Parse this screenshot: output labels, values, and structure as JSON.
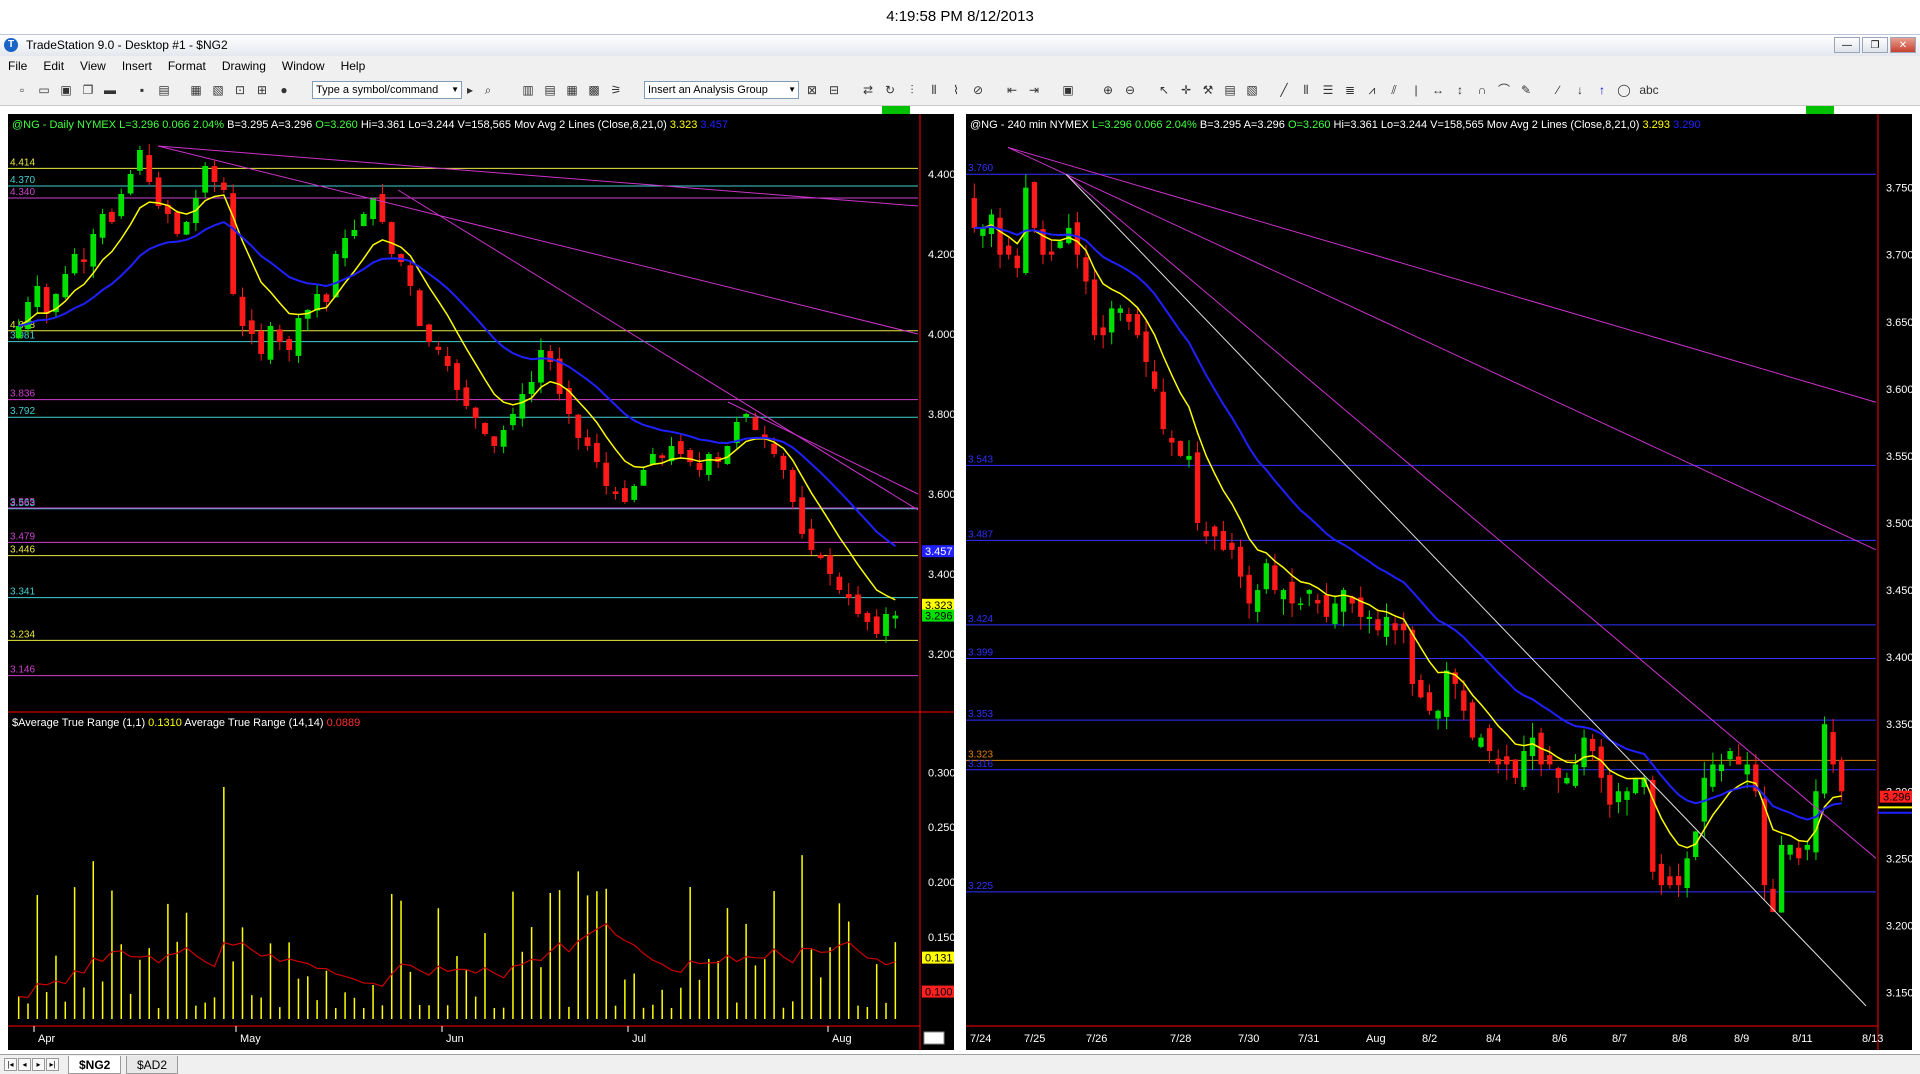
{
  "clock": "4:19:58 PM 8/12/2013",
  "window": {
    "title": "TradeStation 9.0 - Desktop #1 - $NG2"
  },
  "menu": [
    "File",
    "Edit",
    "View",
    "Insert",
    "Format",
    "Drawing",
    "Window",
    "Help"
  ],
  "toolbar": {
    "symbol_placeholder": "Type a symbol/command",
    "analysis_group": "Insert an Analysis Group"
  },
  "tabs": {
    "active": "$NG2",
    "other": "$AD2"
  },
  "colors": {
    "up": "#00e000",
    "down": "#ff1a1a",
    "ma_fast": "#ffff00",
    "ma_slow": "#2020ff",
    "trend": "#cc33cc",
    "support": "#00cccc"
  },
  "left_chart": {
    "header": {
      "symbol": "@NG - Daily",
      "exchange": "NYMEX",
      "last": "L=3.296",
      "change": "0.066",
      "pct": "2.04%",
      "bid": "B=3.295",
      "ask": "A=3.296",
      "open": "O=3.260",
      "high": "Hi=3.361",
      "low": "Lo=3.244",
      "volume": "V=158,565",
      "study": "Mov Avg 2 Lines (Close,8,21,0)",
      "ma_fast": "3.323",
      "ma_slow": "3.457"
    },
    "ylabels": [
      "4.400",
      "4.200",
      "4.000",
      "3.800",
      "3.600",
      "3.400",
      "3.200"
    ],
    "levels": [
      {
        "label": "4.414",
        "value": 4.414,
        "color": "#e8e840"
      },
      {
        "label": "4.370",
        "value": 4.37,
        "color": "#40d0d0"
      },
      {
        "label": "4.340",
        "value": 4.34,
        "color": "#d040d0"
      },
      {
        "label": "4.008",
        "value": 4.008,
        "color": "#e8e840"
      },
      {
        "label": "3.981",
        "value": 3.981,
        "color": "#40d0d0"
      },
      {
        "label": "3.836",
        "value": 3.836,
        "color": "#d040d0"
      },
      {
        "label": "3.792",
        "value": 3.792,
        "color": "#40d0d0"
      },
      {
        "label": "3.563",
        "value": 3.563,
        "color": "#40d0d0"
      },
      {
        "label": "3.565",
        "value": 3.565,
        "color": "#d040d0"
      },
      {
        "label": "3.479",
        "value": 3.479,
        "color": "#d040d0"
      },
      {
        "label": "3.446",
        "value": 3.446,
        "color": "#e8e840"
      },
      {
        "label": "3.341",
        "value": 3.341,
        "color": "#40d0d0"
      },
      {
        "label": "3.234",
        "value": 3.234,
        "color": "#e8e840"
      },
      {
        "label": "3.146",
        "value": 3.146,
        "color": "#d040d0"
      }
    ],
    "price_tags": {
      "ma_fast": "3.323",
      "last": "3.296",
      "ma_slow": "3.457"
    },
    "xlabels": [
      "Apr",
      "May",
      "Jun",
      "Jul",
      "Aug"
    ],
    "atr": {
      "title": "$Average True Range (1,1)",
      "val1": "0.1310",
      "title2": "Average True Range (14,14)",
      "val2": "0.0889",
      "ylabels": [
        "0.300",
        "0.250",
        "0.200",
        "0.150",
        "0.100"
      ],
      "tag1": "0.131",
      "tag2": "0.100"
    }
  },
  "right_chart": {
    "header": {
      "symbol": "@NG - 240 min",
      "exchange": "NYMEX",
      "last": "L=3.296",
      "change": "0.066",
      "pct": "2.04%",
      "bid": "B=3.295",
      "ask": "A=3.296",
      "open": "O=3.260",
      "high": "Hi=3.361",
      "low": "Lo=3.244",
      "volume": "V=158,565",
      "study": "Mov Avg 2 Lines (Close,8,21,0)",
      "ma_fast": "3.293",
      "ma_slow": "3.290"
    },
    "ylabels": [
      "3.750",
      "3.700",
      "3.650",
      "3.600",
      "3.550",
      "3.500",
      "3.450",
      "3.400",
      "3.350",
      "3.300",
      "3.250",
      "3.200",
      "3.150"
    ],
    "levels": [
      {
        "label": "3.760",
        "value": 3.76,
        "color": "#3030ff"
      },
      {
        "label": "3.543",
        "value": 3.543,
        "color": "#3030ff"
      },
      {
        "label": "3.487",
        "value": 3.487,
        "color": "#3030ff"
      },
      {
        "label": "3.424",
        "value": 3.424,
        "color": "#3030ff"
      },
      {
        "label": "3.399",
        "value": 3.399,
        "color": "#3030ff"
      },
      {
        "label": "3.353",
        "value": 3.353,
        "color": "#3030ff"
      },
      {
        "label": "3.323",
        "value": 3.323,
        "color": "#e08000"
      },
      {
        "label": "3.316",
        "value": 3.316,
        "color": "#3030ff"
      },
      {
        "label": "3.225",
        "value": 3.225,
        "color": "#3030ff"
      }
    ],
    "price_tag": "3.296",
    "xlabels": [
      "7/24",
      "7/25",
      "7/26",
      "7/28",
      "7/30",
      "7/31",
      "Aug",
      "8/2",
      "8/4",
      "8/6",
      "8/7",
      "8/8",
      "8/9",
      "8/11",
      "8/13"
    ]
  }
}
